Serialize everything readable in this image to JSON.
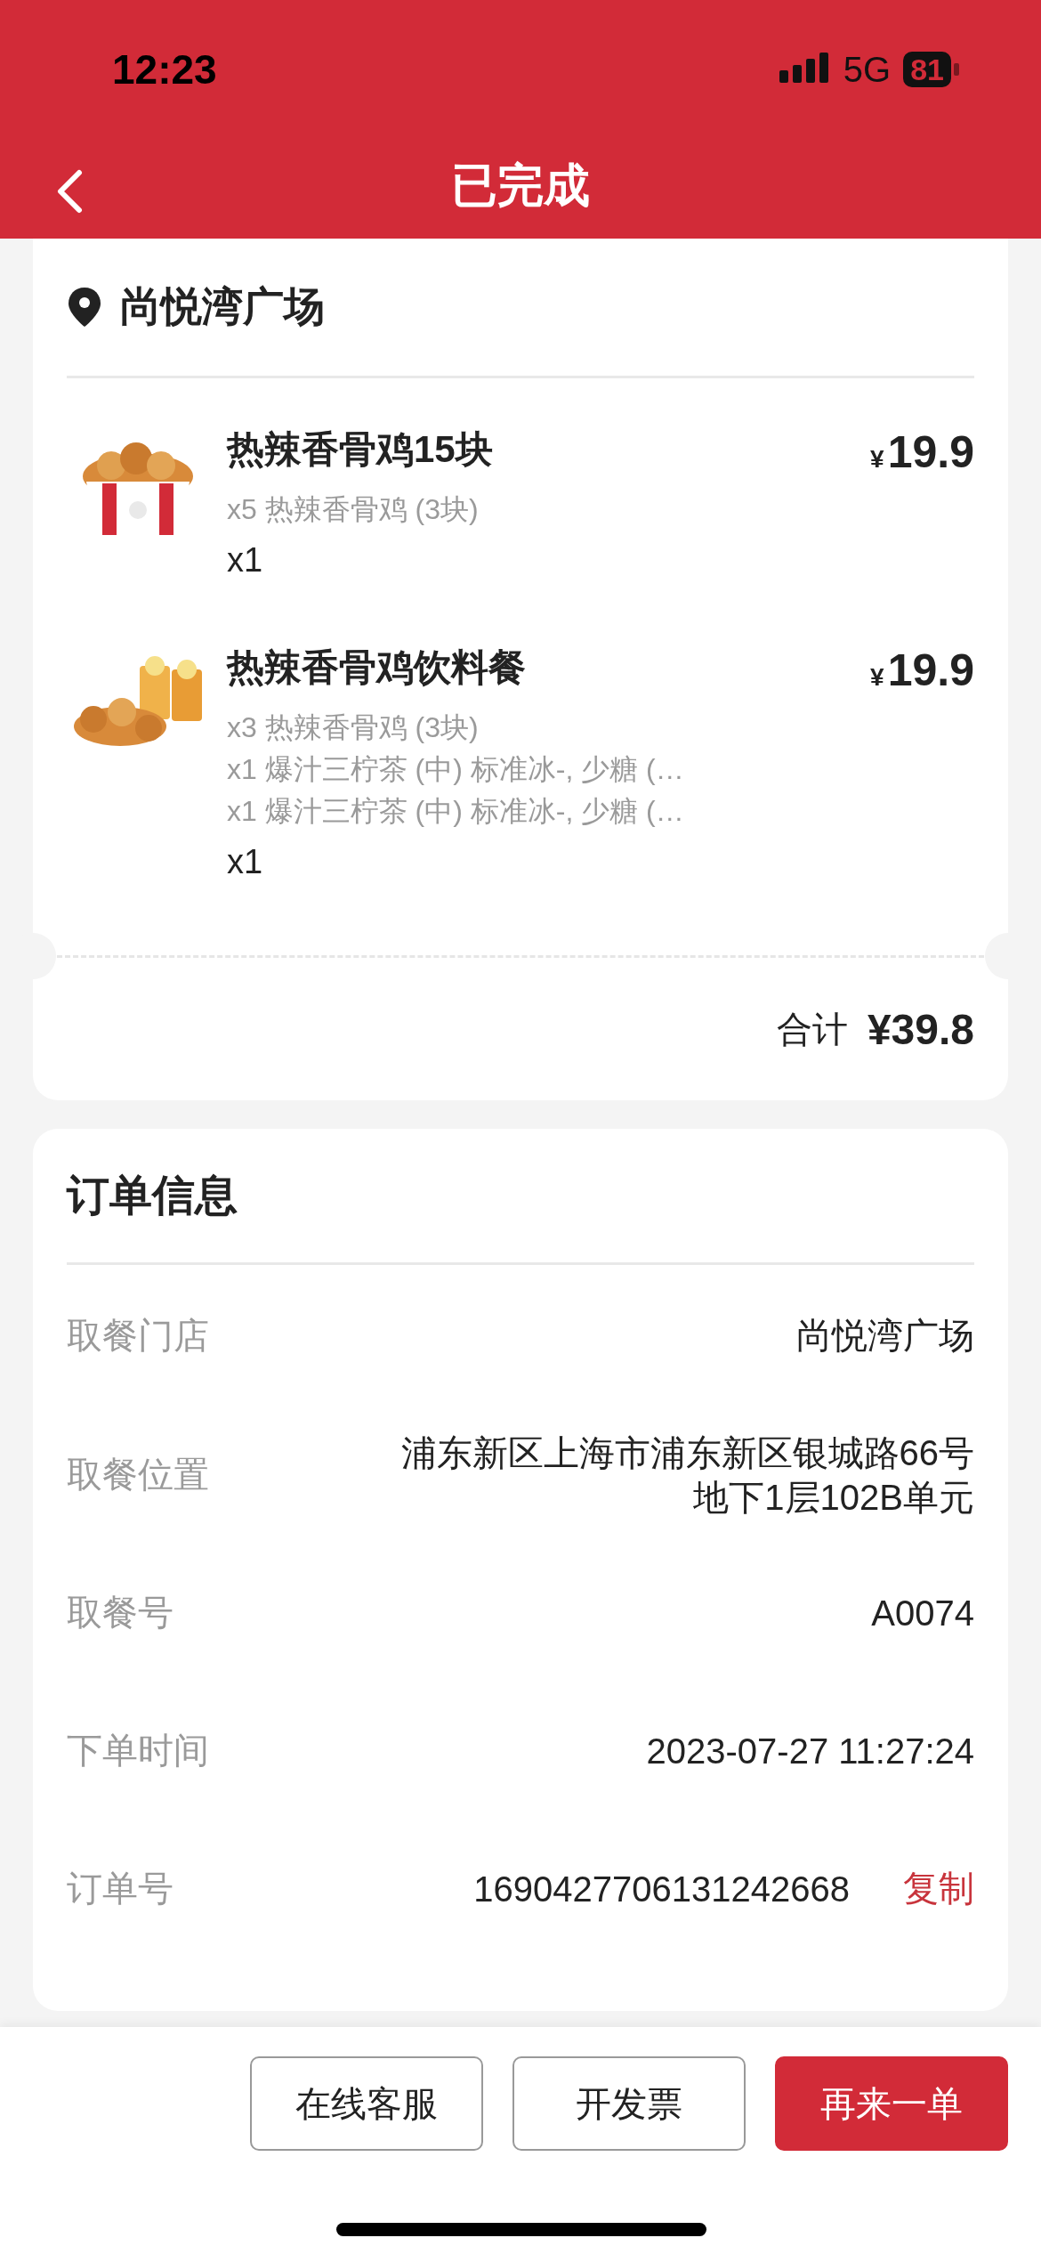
{
  "status_bar": {
    "time": "12:23",
    "network": "5G",
    "battery": "81"
  },
  "header": {
    "title": "已完成"
  },
  "store": {
    "name": "尚悦湾广场"
  },
  "items": [
    {
      "kind": "picture",
      "name": "热辣香骨鸡15块",
      "details": [
        "x5 热辣香骨鸡 (3块)"
      ],
      "quantity": "x1",
      "currency": "¥",
      "price": "19.9"
    },
    {
      "kind": "picture",
      "name": "热辣香骨鸡饮料餐",
      "details": [
        "x3 热辣香骨鸡 (3块)",
        "x1 爆汁三柠茶 (中) 标准冰-, 少糖 (…",
        "x1 爆汁三柠茶 (中) 标准冰-, 少糖 (…"
      ],
      "quantity": "x1",
      "currency": "¥",
      "price": "19.9"
    }
  ],
  "total": {
    "label": "合计",
    "amount": "¥39.8"
  },
  "order_info": {
    "title": "订单信息",
    "rows": [
      {
        "label": "取餐门店",
        "value": "尚悦湾广场"
      },
      {
        "label": "取餐位置",
        "value": "浦东新区上海市浦东新区银城路66号地下1层102B单元"
      },
      {
        "label": "取餐号",
        "value": "A0074"
      },
      {
        "label": "下单时间",
        "value": "2023-07-27 11:27:24"
      },
      {
        "label": "订单号",
        "value": "1690427706131242668",
        "action": "复制"
      }
    ]
  },
  "actions": [
    {
      "label": "在线客服",
      "primary": false
    },
    {
      "label": "开发票",
      "primary": false
    },
    {
      "label": "再来一单",
      "primary": true
    }
  ]
}
